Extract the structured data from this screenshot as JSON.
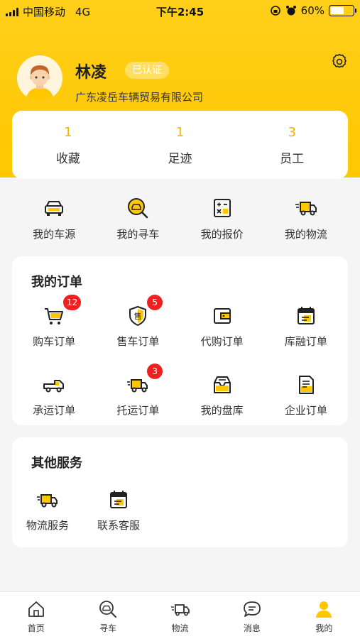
{
  "status_bar": {
    "carrier": "中国移动",
    "network": "4G",
    "time": "下午2:45",
    "battery": "60%"
  },
  "profile": {
    "name": "林凌",
    "verified_label": "已认证",
    "company": "广东凌岳车辆贸易有限公司"
  },
  "stats": [
    {
      "value": "1",
      "label": "收藏"
    },
    {
      "value": "1",
      "label": "足迹"
    },
    {
      "value": "3",
      "label": "员工"
    }
  ],
  "quick_links": [
    {
      "label": "我的车源",
      "icon": "car-icon"
    },
    {
      "label": "我的寻车",
      "icon": "car-search-icon"
    },
    {
      "label": "我的报价",
      "icon": "calculator-icon"
    },
    {
      "label": "我的物流",
      "icon": "truck-icon"
    }
  ],
  "orders": {
    "title": "我的订单",
    "items": [
      {
        "label": "购车订单",
        "icon": "cart-icon",
        "badge": "12"
      },
      {
        "label": "售车订单",
        "icon": "sell-shield-icon",
        "badge": "5"
      },
      {
        "label": "代购订单",
        "icon": "wallet-icon",
        "badge": ""
      },
      {
        "label": "库融订单",
        "icon": "calendar-icon",
        "badge": ""
      },
      {
        "label": "承运订单",
        "icon": "pickup-truck-icon",
        "badge": ""
      },
      {
        "label": "托运订单",
        "icon": "delivery-truck-icon",
        "badge": "3"
      },
      {
        "label": "我的盘库",
        "icon": "inbox-icon",
        "badge": ""
      },
      {
        "label": "企业订单",
        "icon": "document-icon",
        "badge": ""
      }
    ]
  },
  "other_services": {
    "title": "其他服务",
    "items": [
      {
        "label": "物流服务",
        "icon": "logistics-icon"
      },
      {
        "label": "联系客服",
        "icon": "customer-service-icon"
      }
    ]
  },
  "bottom_nav": [
    {
      "label": "首页",
      "icon": "home-icon"
    },
    {
      "label": "寻车",
      "icon": "car-search-icon"
    },
    {
      "label": "物流",
      "icon": "truck-icon"
    },
    {
      "label": "消息",
      "icon": "message-icon"
    },
    {
      "label": "我的",
      "icon": "person-icon"
    }
  ],
  "colors": {
    "accent": "#ffc700",
    "stat_value": "#f0b400",
    "badge": "#f02020"
  }
}
